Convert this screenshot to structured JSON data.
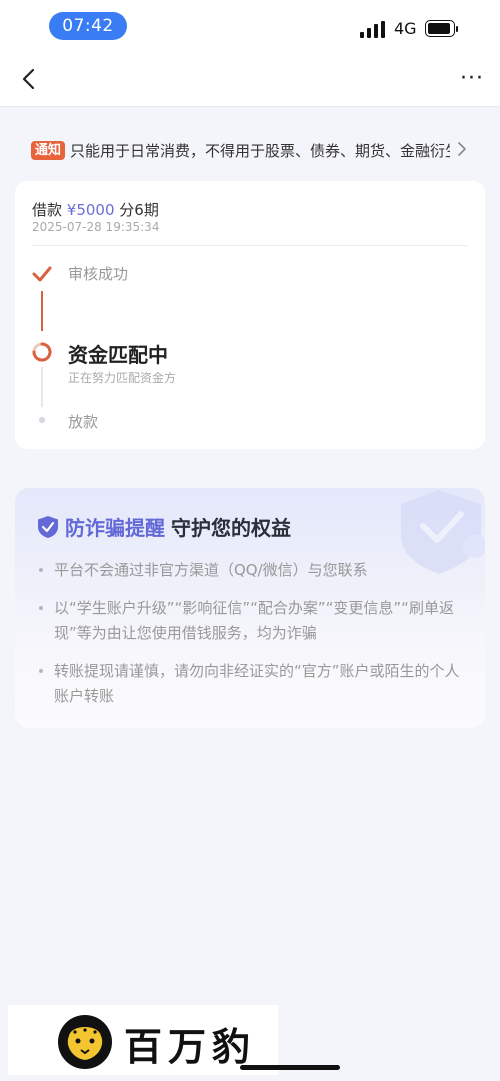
{
  "status_bar": {
    "time": "07:42",
    "network": "4G"
  },
  "nav": {
    "back_icon": "chevron-left-icon",
    "more_icon": "more-dots-icon",
    "more_label": "···"
  },
  "notice": {
    "badge": "通知",
    "text": "只能用于日常消费，不得用于股票、债券、期货、金融衍生品",
    "arrow_icon": "chevron-right-icon"
  },
  "loan": {
    "label": "借款",
    "amount": "¥5000",
    "installments": "分6期",
    "timestamp": "2025-07-28 19:35:34",
    "steps": [
      {
        "label": "审核成功",
        "status": "done",
        "icon": "check-icon"
      },
      {
        "label": "资金匹配中",
        "sub": "正在努力匹配资金方",
        "status": "in-progress",
        "icon": "loading-icon"
      },
      {
        "label": "放款",
        "status": "pending",
        "icon": "dot-icon"
      }
    ]
  },
  "fraud": {
    "title_highlight": "防诈骗提醒",
    "title_rest": "守护您的权益",
    "items": [
      "平台不会通过非官方渠道（QQ/微信）与您联系",
      "以“学生账户升级”“影响征信”“配合办案”“变更信息”“刷单返现”等为由让您使用借钱服务，均为诈骗",
      "转账提现请谨慎，请勿向非经证实的“官方”账户或陌生的个人账户转账"
    ]
  },
  "watermark": {
    "text": "百万豹"
  },
  "colors": {
    "accent": "#3a7cf3",
    "brand_purple": "#6a6ed8",
    "notice_orange": "#e8623c",
    "step_done": "#d9613f"
  }
}
